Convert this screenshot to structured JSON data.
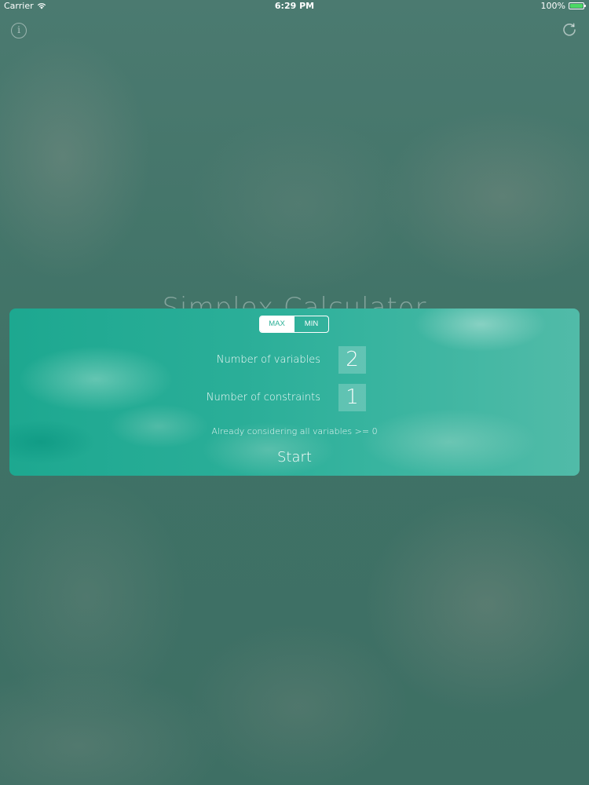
{
  "status_bar": {
    "carrier": "Carrier",
    "time": "6:29 PM",
    "battery_percent": "100%",
    "battery_level": 1.0,
    "battery_color": "#4cd964"
  },
  "icons": {
    "info": "info-icon",
    "refresh": "refresh-icon",
    "wifi": "wifi-icon"
  },
  "app_title": "Simplex Calculator",
  "card": {
    "mode_options": [
      "MAX",
      "MIN"
    ],
    "mode_selected": "MAX",
    "variables_label": "Number of variables",
    "variables_value": "2",
    "constraints_label": "Number of constraints",
    "constraints_value": "1",
    "note": "Already considering all variables >= 0",
    "start_label": "Start"
  },
  "colors": {
    "accent": "#2aaf96",
    "background": "#4a7a70"
  }
}
